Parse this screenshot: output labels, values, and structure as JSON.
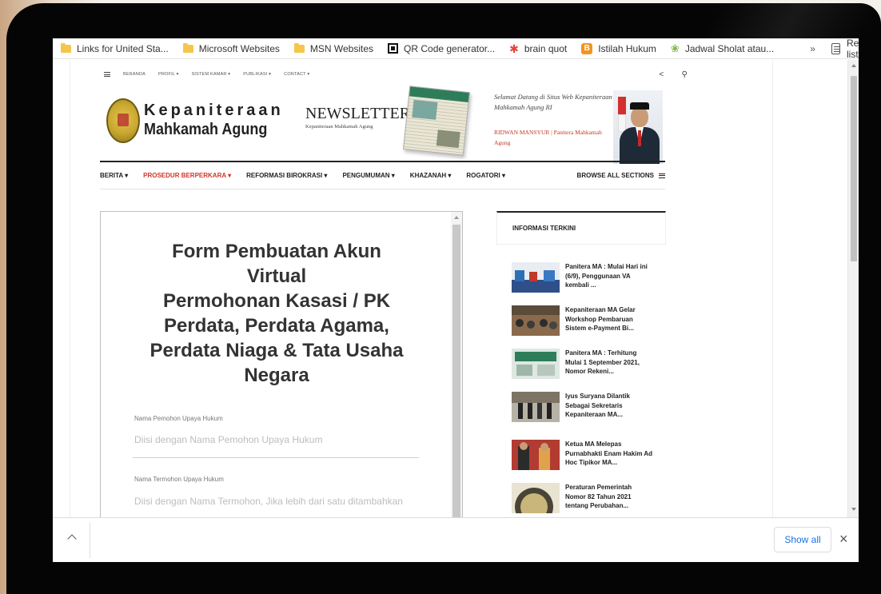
{
  "bookmarks": [
    {
      "label": "Links for United Sta...",
      "icon": "folder-icon"
    },
    {
      "label": "Microsoft Websites",
      "icon": "folder-icon"
    },
    {
      "label": "MSN Websites",
      "icon": "folder-icon"
    },
    {
      "label": "QR Code generator...",
      "icon": "qr-icon"
    },
    {
      "label": "brain quot",
      "icon": "pinwheel-icon"
    },
    {
      "label": "Istilah Hukum",
      "icon": "blogger-icon"
    },
    {
      "label": "Jadwal Sholat atau...",
      "icon": "leaf-icon"
    }
  ],
  "bookmarks_more": "»",
  "reading_list": "Reading list",
  "topnav": {
    "items": [
      "BERANDA",
      "PROFIL ▾",
      "SISTEM KAMAR ▾",
      "PUBLIKASI ▾",
      "CONTACT ▾"
    ],
    "share_icon": "share-icon",
    "search_icon": "search-icon"
  },
  "header": {
    "logo_line1": "Kepaniteraan",
    "logo_line2": "Mahkamah Agung",
    "newsletter_title": "NEWSLETTER",
    "newsletter_sub": "Kepaniteraan Mahkamah Agung",
    "newsletter_paper_label": "KEPANITERAAN",
    "welcome_line": "Selamat Datang di Situs Web Kepaniteraan Mahkamah Agung RI",
    "welcome_name": "RIDWAN MANSYUR | Panitera Mahkamah Agung"
  },
  "mainnav": {
    "items": [
      "BERITA ▾",
      "PROSEDUR BERPERKARA ▾",
      "REFORMASI BIROKRASI ▾",
      "PENGUMUMAN ▾",
      "KHAZANAH ▾",
      "ROGATORI ▾"
    ],
    "active_index": 1,
    "browse_label": "BROWSE ALL SECTIONS",
    "active_color": "#d0352b"
  },
  "form": {
    "title_lines": [
      "Form Pembuatan Akun",
      "Virtual",
      "Permohonan Kasasi / PK",
      "Perdata, Perdata Agama,",
      "Perdata Niaga & Tata Usaha",
      "Negara"
    ],
    "field1_label": "Nama Pemohon Upaya Hukum",
    "field1_placeholder": "Diisi dengan Nama Pemohon Upaya Hukum",
    "field2_label": "Nama Termohon Upaya Hukum",
    "field2_placeholder": "Diisi dengan Nama Termohon, Jika lebih dari satu ditambahkan"
  },
  "sidebar": {
    "heading": "INFORMASI TERKINI",
    "items": [
      {
        "title": "Panitera MA : Mulai Hari ini (6/9), Penggunaan VA kembali ..."
      },
      {
        "title": "Kepaniteraan MA Gelar Workshop Pembaruan Sistem e-Payment Bi..."
      },
      {
        "title": "Panitera MA : Terhitung Mulai 1 September 2021, Nomor Rekeni..."
      },
      {
        "title": "Iyus Suryana Dilantik Sebagai Sekretaris Kepaniteraan MA..."
      },
      {
        "title": "Ketua MA Melepas Purnabhakti Enam Hakim Ad Hoc Tipikor MA..."
      },
      {
        "title": "Peraturan Pemerintah Nomor 82 Tahun 2021 tentang Perubahan..."
      }
    ]
  },
  "downloads": {
    "show_all": "Show all",
    "close": "×"
  }
}
